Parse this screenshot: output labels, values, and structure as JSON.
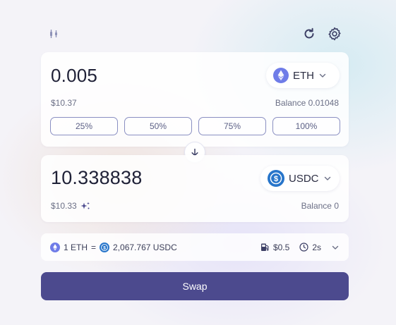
{
  "header": {
    "chart_icon": "candlestick-icon",
    "refresh_icon": "refresh-icon",
    "settings_icon": "gear-icon"
  },
  "sell": {
    "amount": "0.005",
    "token": "ETH",
    "fiat": "$10.37",
    "balance_label": "Balance",
    "balance_value": "0.01048",
    "percent_buttons": [
      "25%",
      "50%",
      "75%",
      "100%"
    ]
  },
  "buy": {
    "amount": "10.338838",
    "token": "USDC",
    "fiat": "$10.33",
    "balance_label": "Balance",
    "balance_value": "0"
  },
  "rate": {
    "lhs": "1 ETH",
    "equals": "=",
    "rhs": "2,067.767 USDC",
    "gas": "$0.5",
    "time": "2s"
  },
  "swap_label": "Swap",
  "colors": {
    "accent": "#4c4a8e",
    "eth": "#6f7ce8",
    "usdc": "#2775ca",
    "muted": "#6b6f86"
  }
}
